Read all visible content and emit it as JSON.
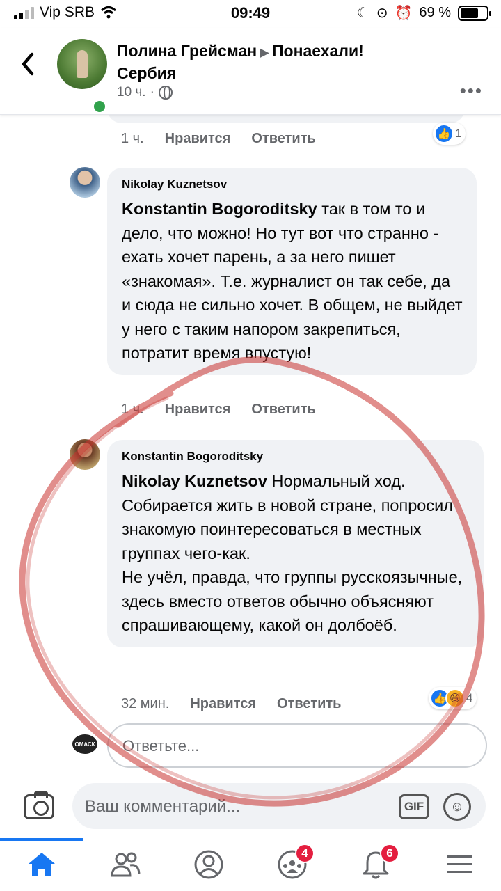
{
  "status_bar": {
    "carrier": "Vip SRB",
    "time": "09:49",
    "battery": "69 %",
    "battery_level": 0.69
  },
  "post_header": {
    "author": "Полина Грейсман",
    "group": "Понаехали! Сербия",
    "time": "10 ч.",
    "separator": "·"
  },
  "comments": [
    {
      "time": "1 ч.",
      "like_label": "Нравится",
      "reply_label": "Ответить",
      "reaction_count": "1"
    },
    {
      "author": "Nikolay Kuznetsov",
      "tag": "Konstantin Bogoroditsky",
      "text": " так в том то и дело, что можно! Но тут вот что странно - ехать хочет парень, а за него пишет «знакомая». Т.е. журналист он так себе, да и сюда не сильно хочет. В общем, не выйдет у него с таким напором закрепиться, потратит время впустую!",
      "time": "1 ч.",
      "like_label": "Нравится",
      "reply_label": "Ответить"
    },
    {
      "author": "Konstantin Bogoroditsky",
      "tag": "Nikolay Kuznetsov",
      "text": " Нормальный ход. Собирается жить в новой стране, попросил знакомую поинтересоваться в местных группах чего-как.\nНе учёл, правда, что группы русскоязычные, здесь вместо ответов обычно объясняют спрашивающему, какой он долбоёб.",
      "time": "32 мин.",
      "like_label": "Нравится",
      "reply_label": "Ответить",
      "reaction_count": "4"
    }
  ],
  "reply_input": {
    "placeholder": "Ответьте...",
    "avatar_text": "ОМАСК"
  },
  "composer": {
    "placeholder": "Ваш комментарий...",
    "gif_label": "GIF"
  },
  "bottom_nav": {
    "groups_badge": "4",
    "notifications_badge": "6"
  },
  "colors": {
    "accent": "#1877f2",
    "bubble": "#f0f2f5",
    "online": "#31a24c",
    "badge": "#e41e3f",
    "annotation": "#c8322d"
  }
}
